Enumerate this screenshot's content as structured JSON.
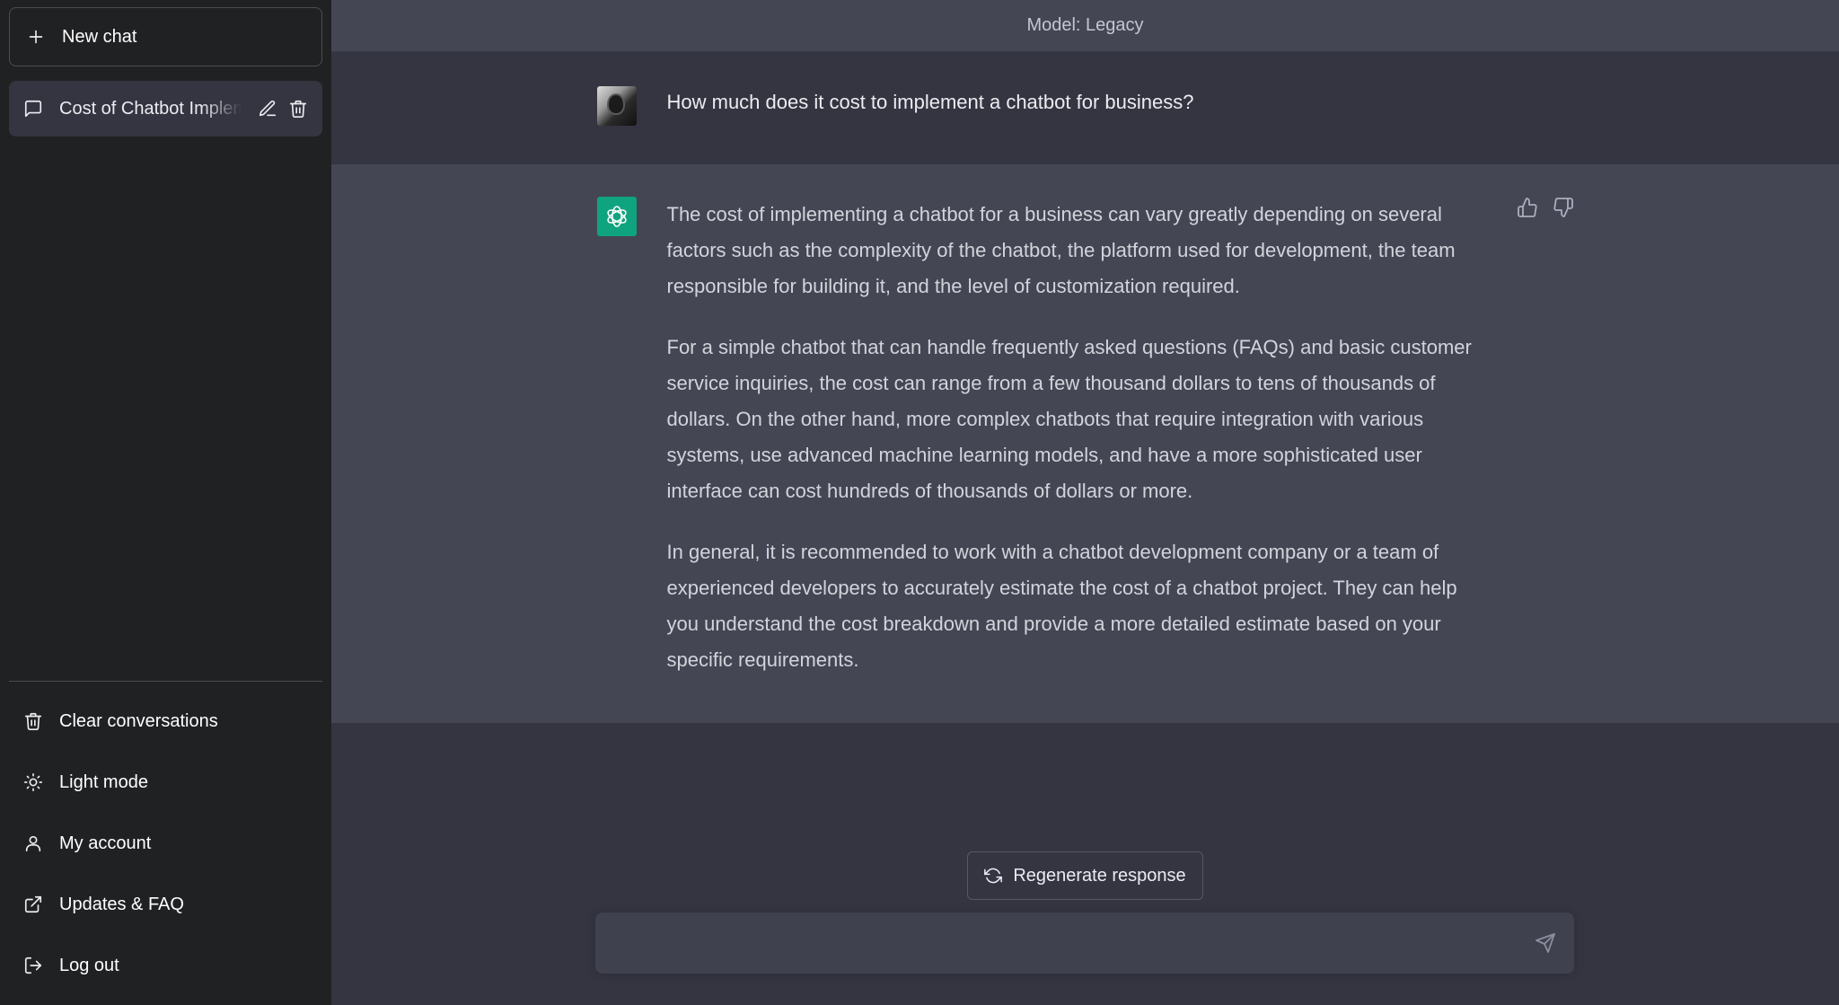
{
  "sidebar": {
    "new_chat_label": "New chat",
    "conversations": [
      {
        "title": "Cost of Chatbot Implementation"
      }
    ],
    "menu": {
      "clear": "Clear conversations",
      "light_mode": "Light mode",
      "account": "My account",
      "updates": "Updates & FAQ",
      "logout": "Log out"
    }
  },
  "header": {
    "model_label": "Model: Legacy"
  },
  "chat": {
    "user_message": "How much does it cost to implement a chatbot for business?",
    "assistant_paragraphs": [
      "The cost of implementing a chatbot for a business can vary greatly depending on several factors such as the complexity of the chatbot, the platform used for development, the team responsible for building it, and the level of customization required.",
      "For a simple chatbot that can handle frequently asked questions (FAQs) and basic customer service inquiries, the cost can range from a few thousand dollars to tens of thousands of dollars. On the other hand, more complex chatbots that require integration with various systems, use advanced machine learning models, and have a more sophisticated user interface can cost hundreds of thousands of dollars or more.",
      "In general, it is recommended to work with a chatbot development company or a team of experienced developers to accurately estimate the cost of a chatbot project. They can help you understand the cost breakdown and provide a more detailed estimate based on your specific requirements."
    ]
  },
  "composer": {
    "regenerate_label": "Regenerate response",
    "input_value": ""
  },
  "colors": {
    "sidebar_bg": "#202123",
    "main_bg": "#343541",
    "assistant_bg": "#444654",
    "bot_avatar": "#10a37f"
  },
  "icons": [
    "plus-icon",
    "chat-bubble-icon",
    "pencil-icon",
    "trash-icon",
    "sun-icon",
    "user-icon",
    "external-link-icon",
    "logout-icon",
    "thumbs-up-icon",
    "thumbs-down-icon",
    "refresh-icon",
    "send-icon",
    "openai-logo-icon"
  ]
}
